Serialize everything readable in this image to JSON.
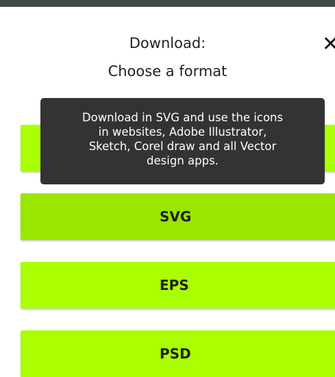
{
  "dialog": {
    "title_line1": "Download:",
    "title_line2": "Choose a format",
    "close_glyph": "✕"
  },
  "tooltip": {
    "lines": [
      "Download in SVG and use the icons",
      "in websites, Adobe Illustrator,",
      "Sketch, Corel draw and all Vector",
      "design apps."
    ]
  },
  "formats": {
    "svg_label": "SVG",
    "eps_label": "EPS",
    "psd_label": "PSD"
  },
  "colors": {
    "top_bar": "#3f4b4b",
    "button_green": "#aaff00",
    "button_green_hover": "#99e600",
    "tooltip_bg": "#333333"
  }
}
